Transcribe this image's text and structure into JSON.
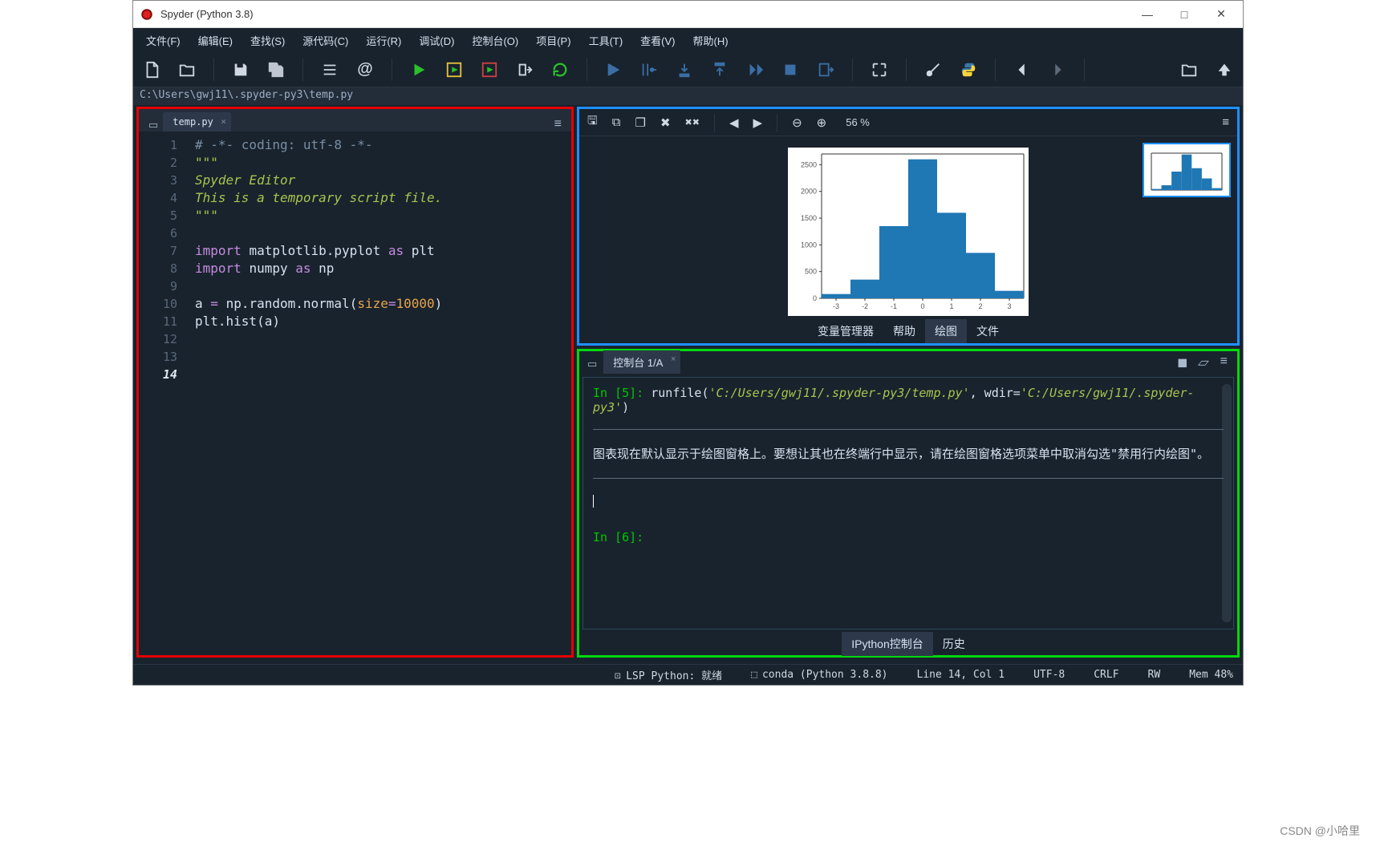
{
  "window": {
    "title": "Spyder (Python 3.8)"
  },
  "menu": {
    "file": "文件(F)",
    "edit": "编辑(E)",
    "search": "查找(S)",
    "source": "源代码(C)",
    "run": "运行(R)",
    "debug": "调试(D)",
    "consoles": "控制台(O)",
    "projects": "项目(P)",
    "tools": "工具(T)",
    "view": "查看(V)",
    "help": "帮助(H)"
  },
  "pathbar": {
    "path": "C:\\Users\\gwj11\\.spyder-py3\\temp.py"
  },
  "editor": {
    "tab_name": "temp.py",
    "lines": [
      {
        "n": 1,
        "type": "comment",
        "text": "# -*- coding: utf-8 -*-"
      },
      {
        "n": 2,
        "type": "string",
        "text": "\"\"\""
      },
      {
        "n": 3,
        "type": "string",
        "text": "Spyder Editor"
      },
      {
        "n": 4,
        "type": "string",
        "text": ""
      },
      {
        "n": 5,
        "type": "string",
        "text": "This is a temporary script file."
      },
      {
        "n": 6,
        "type": "string",
        "text": "\"\"\""
      },
      {
        "n": 7,
        "type": "blank",
        "text": ""
      },
      {
        "n": 8,
        "type": "import",
        "kw": "import",
        "mod": "matplotlib.pyplot",
        "as": "as",
        "alias": "plt"
      },
      {
        "n": 9,
        "type": "import",
        "kw": "import",
        "mod": "numpy",
        "as": "as",
        "alias": "np"
      },
      {
        "n": 10,
        "type": "blank",
        "text": ""
      },
      {
        "n": 11,
        "type": "assign",
        "lhs": "a",
        "op": "=",
        "call": "np.random.normal",
        "lparen": "(",
        "kwarg": "size",
        "eq": "=",
        "num": "10000",
        "rparen": ")"
      },
      {
        "n": 12,
        "type": "call",
        "call": "plt.hist",
        "lparen": "(",
        "arg": "a",
        "rparen": ")"
      },
      {
        "n": 13,
        "type": "blank",
        "text": ""
      }
    ],
    "current_line": "14"
  },
  "plot_pane": {
    "zoom": "56 %",
    "tabs": {
      "var": "变量管理器",
      "help": "帮助",
      "plot": "绘图",
      "file": "文件"
    }
  },
  "chart_data": {
    "type": "bar",
    "x": [
      -3,
      -2,
      -1,
      0,
      1,
      2,
      3
    ],
    "x_tick_labels": [
      "-3",
      "-2",
      "-1",
      "0",
      "1",
      "2",
      "3"
    ],
    "values": [
      80,
      350,
      1350,
      2600,
      1600,
      850,
      140
    ],
    "ylim": [
      0,
      2700
    ],
    "y_ticks": [
      0,
      500,
      1000,
      1500,
      2000,
      2500
    ],
    "title": "",
    "xlabel": "",
    "ylabel": ""
  },
  "console": {
    "tab_name": "控制台 1/A",
    "in_prefix_5": "In [5]:",
    "runfile_call": "runfile",
    "runfile_arg1": "'C:/Users/gwj11/.spyder-py3/temp.py'",
    "runfile_wdir_kw": "wdir=",
    "runfile_wdir_val": "'C:/Users/gwj11/.spyder-py3'",
    "message": "图表现在默认显示于绘图窗格上。要想让其也在终端行中显示，请在绘图窗格选项菜单中取消勾选\"禁用行内绘图\"。",
    "in_prefix_6": "In [6]:",
    "bottom_tabs": {
      "ipython": "IPython控制台",
      "history": "历史"
    }
  },
  "status": {
    "lsp": "LSP Python: 就绪",
    "env": "conda (Python 3.8.8)",
    "cursor": "Line 14, Col 1",
    "encoding": "UTF-8",
    "eol": "CRLF",
    "mode": "RW",
    "mem": "Mem 48%"
  },
  "watermark": "CSDN @小哈里"
}
